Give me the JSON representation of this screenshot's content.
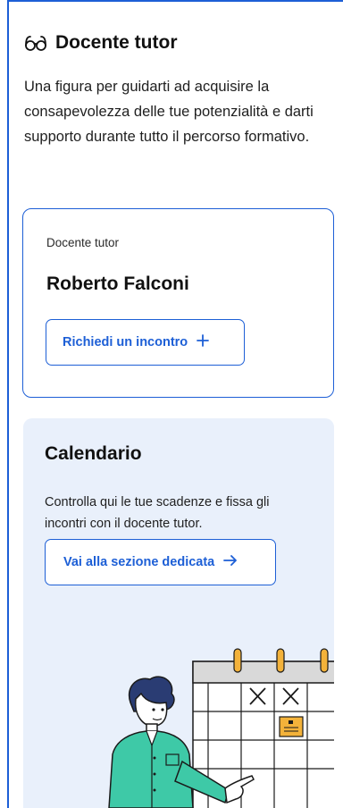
{
  "header": {
    "icon": "glasses-icon",
    "title": "Docente tutor"
  },
  "intro": "Una figura per guidarti ad acquisire la consapevolezza delle tue potenzialità e darti supporto durante tutto il percorso formativo.",
  "tutor_card": {
    "label": "Docente tutor",
    "name": "Roberto Falconi",
    "button_label": "Richiedi un incontro",
    "button_icon": "plus-icon"
  },
  "calendar_card": {
    "title": "Calendario",
    "description": "Controlla qui le tue scadenze e fissa gli incontri con il docente tutor.",
    "button_label": "Vai alla sezione dedicata",
    "button_icon": "arrow-right-icon",
    "illustration": "calendar-person-illustration"
  },
  "colors": {
    "accent": "#1d5fd6",
    "card_background": "#e9f0fb",
    "highlight": "#f3b23a",
    "shirt": "#3ec9a7"
  }
}
